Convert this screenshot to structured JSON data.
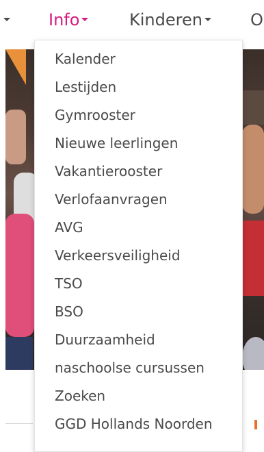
{
  "nav": {
    "info_label": "Info",
    "kinderen_label": "Kinderen",
    "next_label": "O",
    "active_color": "#d81b7f",
    "text_color": "#4a4a4a"
  },
  "dropdown": {
    "items": [
      "Kalender",
      "Lestijden",
      "Gymrooster",
      "Nieuwe leerlingen",
      "Vakantierooster",
      "Verlofaanvragen",
      "AVG",
      "Verkeersveiligheid",
      "TSO",
      "BSO",
      "Duurzaamheid",
      "naschoolse cursussen",
      "Zoeken",
      "GGD Hollands Noorden"
    ]
  },
  "icons": {
    "caret": "caret-down-icon"
  }
}
